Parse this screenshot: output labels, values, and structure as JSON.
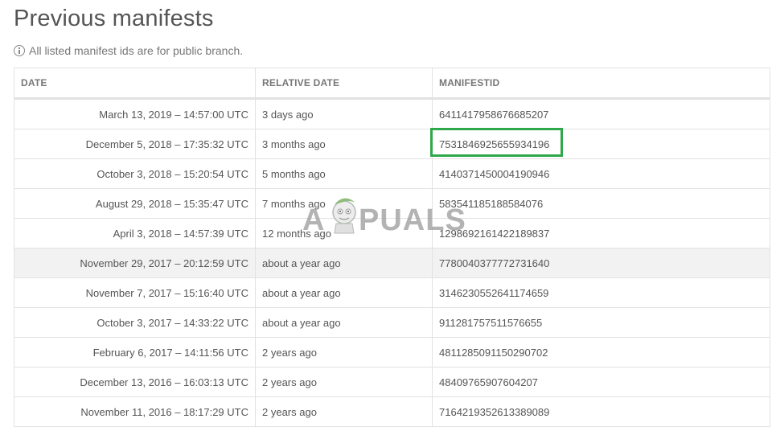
{
  "page": {
    "title": "Previous manifests",
    "note": "All listed manifest ids are for public branch."
  },
  "table": {
    "headers": [
      "DATE",
      "RELATIVE DATE",
      "MANIFESTID"
    ],
    "rows": [
      {
        "date": "March 13, 2019 – 14:57:00 UTC",
        "relative": "3 days ago",
        "manifest": "6411417958676685207"
      },
      {
        "date": "December 5, 2018 – 17:35:32 UTC",
        "relative": "3 months ago",
        "manifest": "7531846925655934196"
      },
      {
        "date": "October 3, 2018 – 15:20:54 UTC",
        "relative": "5 months ago",
        "manifest": "4140371450004190946"
      },
      {
        "date": "August 29, 2018 – 15:35:47 UTC",
        "relative": "7 months ago",
        "manifest": "583541185188584076"
      },
      {
        "date": "April 3, 2018 – 14:57:39 UTC",
        "relative": "12 months ago",
        "manifest": "1298692161422189837"
      },
      {
        "date": "November 29, 2017 – 20:12:59 UTC",
        "relative": "about a year ago",
        "manifest": "7780040377772731640"
      },
      {
        "date": "November 7, 2017 – 15:16:40 UTC",
        "relative": "about a year ago",
        "manifest": "3146230552641174659"
      },
      {
        "date": "October 3, 2017 – 14:33:22 UTC",
        "relative": "about a year ago",
        "manifest": "911281757511576655"
      },
      {
        "date": "February 6, 2017 – 14:11:56 UTC",
        "relative": "2 years ago",
        "manifest": "4811285091150290702"
      },
      {
        "date": "December 13, 2016 – 16:03:13 UTC",
        "relative": "2 years ago",
        "manifest": "48409765907604207"
      },
      {
        "date": "November 11, 2016 – 18:17:29 UTC",
        "relative": "2 years ago",
        "manifest": "7164219352613389089"
      }
    ]
  },
  "watermark": {
    "text": "APPUALS"
  },
  "colors": {
    "highlight": "#2ea84a",
    "shaded_row": "#f2f2f2",
    "border": "#e2e2e2"
  },
  "icons": {
    "note_icon": "info-icon",
    "watermark_icon": "appuals-mascot-icon"
  }
}
